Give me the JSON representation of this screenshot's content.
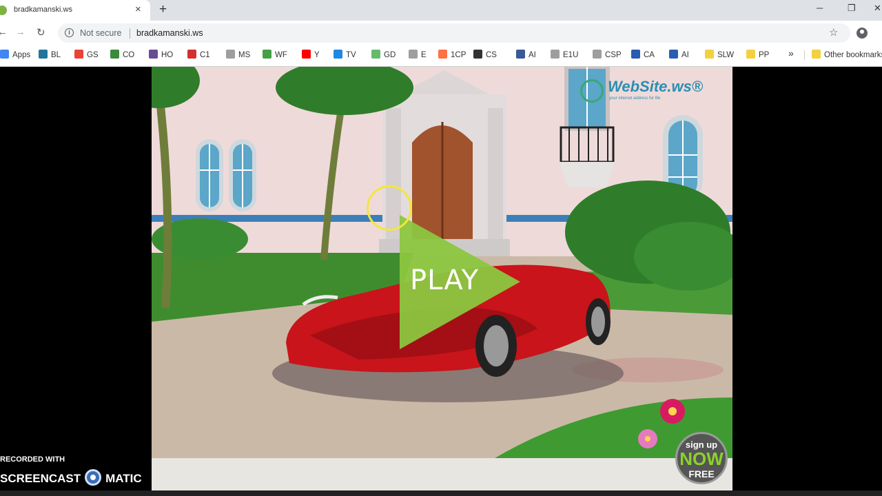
{
  "browser": {
    "tab_title": "bradkamanski.ws",
    "tab_close": "×",
    "new_tab": "+",
    "security_label": "Not secure",
    "url": "bradkamanski.ws",
    "info_glyph": "i",
    "minimize": "─",
    "restore": "❐",
    "close": "✕",
    "back": "←",
    "forward": "→",
    "reload": "↻",
    "star": "☆"
  },
  "bookmarks": [
    {
      "label": "Apps",
      "color": "#4285f4"
    },
    {
      "label": "BL",
      "color": "#21759b"
    },
    {
      "label": "GS",
      "color": "#ea4335"
    },
    {
      "label": "CO",
      "color": "#3b8a3b"
    },
    {
      "label": "HO",
      "color": "#6a4c93"
    },
    {
      "label": "C1",
      "color": "#d32f2f"
    },
    {
      "label": "MS",
      "color": "#9e9e9e"
    },
    {
      "label": "WF",
      "color": "#43a047"
    },
    {
      "label": "Y",
      "color": "#ff0000"
    },
    {
      "label": "TV",
      "color": "#1e88e5"
    },
    {
      "label": "GD",
      "color": "#66bb6a"
    },
    {
      "label": "E",
      "color": "#9e9e9e"
    },
    {
      "label": "1CP",
      "color": "#ff7043"
    },
    {
      "label": "CS",
      "color": "#333333"
    },
    {
      "label": "AI",
      "color": "#3b5998"
    },
    {
      "label": "E1U",
      "color": "#9e9e9e"
    },
    {
      "label": "CSP",
      "color": "#9e9e9e"
    },
    {
      "label": "CA",
      "color": "#2a5db0"
    },
    {
      "label": "AI",
      "color": "#2a5db0"
    },
    {
      "label": "SLW",
      "color": "#f4d03f"
    },
    {
      "label": "PP",
      "color": "#f4d03f"
    }
  ],
  "bookmarks_more": "»",
  "other_bookmarks": "Other bookmarks",
  "game": {
    "play_label": "PLAY",
    "logo_title": "WebSite.ws®",
    "logo_tagline": "your internet address for life",
    "signup_line1": "sign up",
    "signup_line2": "NOW",
    "signup_line3": "FREE"
  },
  "watermark": {
    "line1": "RECORDED WITH",
    "line2a": "SCREENCAST",
    "line2b": "MATIC"
  }
}
